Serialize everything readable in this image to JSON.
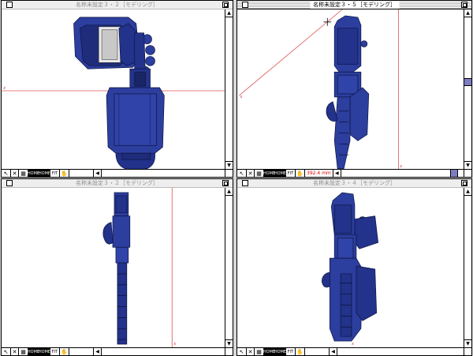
{
  "windows": [
    {
      "id": "w1",
      "title": "名称未設定３・２［モデリング］",
      "active": false,
      "axis_labels": [
        "z"
      ],
      "readout": "",
      "hthumb": 0.5,
      "vthumb": 0.5
    },
    {
      "id": "w2",
      "title": "名称未設定３・５［モデリング］",
      "active": true,
      "axis_labels": [
        "x",
        "z"
      ],
      "readout": "392.4 mm",
      "hthumb": 0.95,
      "vthumb": 0.45
    },
    {
      "id": "w3",
      "title": "名称未設定３・２［モデリング］",
      "active": false,
      "axis_labels": [
        "x"
      ],
      "readout": "",
      "hthumb": 0.5,
      "vthumb": 0.5
    },
    {
      "id": "w4",
      "title": "名称未設定３・４［モデリング］",
      "active": false,
      "axis_labels": [
        "x"
      ],
      "readout": "",
      "hthumb": 0.5,
      "vthumb": 0.5
    }
  ],
  "toolbar": {
    "tool_labels": [
      "HOME",
      "HOME",
      "FIT"
    ]
  },
  "colors": {
    "model_fill": "#2c3e9e",
    "model_dark": "#1a2566",
    "guide_line": "#e05050",
    "active_thumb": "#7d7dc0"
  }
}
